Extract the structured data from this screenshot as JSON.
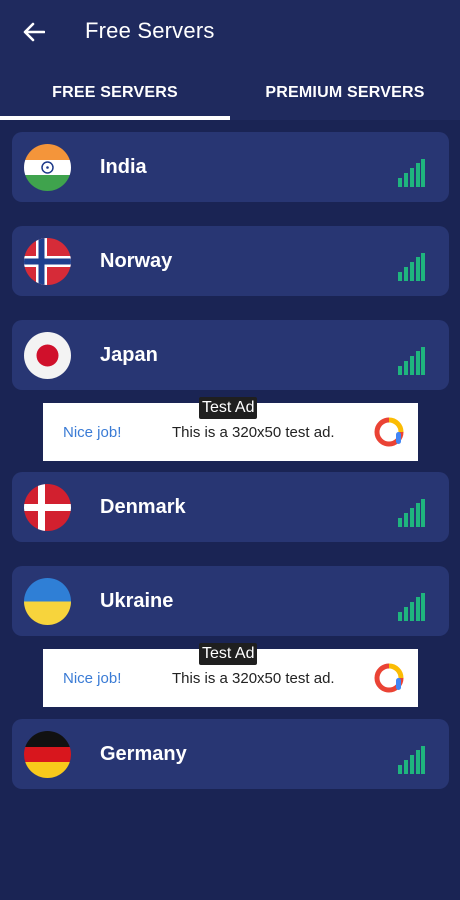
{
  "appbar": {
    "title": "Free Servers",
    "back_icon": "arrow-left-icon"
  },
  "tabs": [
    {
      "label": "FREE SERVERS",
      "selected": true
    },
    {
      "label": "PREMIUM SERVERS",
      "selected": false
    }
  ],
  "colors": {
    "background": "#1a2454",
    "header": "#1f2a5e",
    "card": "#283673",
    "signal": "#1fb57e",
    "ad_link": "#3a7bd5"
  },
  "servers": [
    {
      "country": "India",
      "flag_icon": "india-flag-icon",
      "signal_icon": "signal-strength-icon"
    },
    {
      "country": "Norway",
      "flag_icon": "norway-flag-icon",
      "signal_icon": "signal-strength-icon"
    },
    {
      "country": "Japan",
      "flag_icon": "japan-flag-icon",
      "signal_icon": "signal-strength-icon"
    },
    {
      "country": "Denmark",
      "flag_icon": "denmark-flag-icon",
      "signal_icon": "signal-strength-icon"
    },
    {
      "country": "Ukraine",
      "flag_icon": "ukraine-flag-icon",
      "signal_icon": "signal-strength-icon"
    },
    {
      "country": "Germany",
      "flag_icon": "germany-flag-icon",
      "signal_icon": "signal-strength-icon"
    }
  ],
  "ads": [
    {
      "label": "Test Ad",
      "nice": "Nice job!",
      "text": "This is a 320x50 test ad.",
      "logo_icon": "admob-logo-icon"
    },
    {
      "label": "Test Ad",
      "nice": "Nice job!",
      "text": "This is a 320x50 test ad.",
      "logo_icon": "admob-logo-icon"
    }
  ]
}
